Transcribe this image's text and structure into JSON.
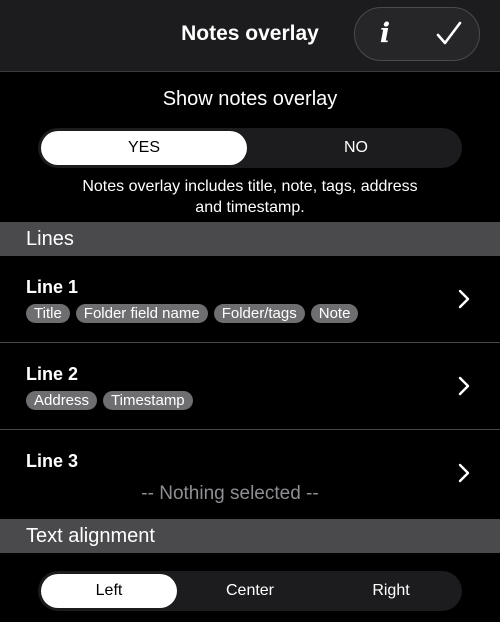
{
  "header": {
    "title": "Notes overlay",
    "info_label": "i"
  },
  "overlay": {
    "heading": "Show notes overlay",
    "options": [
      "YES",
      "NO"
    ],
    "selected": "YES",
    "description_line1": "Notes overlay includes title, note, tags, address",
    "description_line2": "and timestamp."
  },
  "lines_section": {
    "title": "Lines",
    "rows": [
      {
        "label": "Line 1",
        "tags": [
          "Title",
          "Folder field name",
          "Folder/tags",
          "Note"
        ]
      },
      {
        "label": "Line 2",
        "tags": [
          "Address",
          "Timestamp"
        ]
      },
      {
        "label": "Line 3",
        "empty_text": "-- Nothing selected --"
      }
    ]
  },
  "alignment_section": {
    "title": "Text alignment",
    "options": [
      "Left",
      "Center",
      "Right"
    ],
    "selected": "Left"
  },
  "icons": {
    "info": "info-icon",
    "done": "checkmark-icon",
    "row_disclosure": "chevron-right-icon"
  },
  "colors": {
    "background": "#000000",
    "header": "#1c1c1e",
    "section_header": "#4a4a4c",
    "tag": "#6e6e70",
    "muted_text": "#8e8e93"
  }
}
